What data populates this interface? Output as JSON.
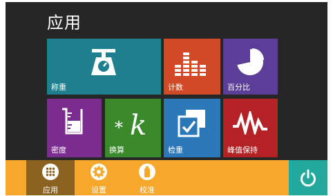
{
  "header": {
    "title": "应用"
  },
  "tiles": [
    {
      "label": "称重",
      "icon": "scale-icon",
      "color": "#1f7f8f"
    },
    {
      "label": "计数",
      "icon": "count-bars-icon",
      "color": "#d24a25"
    },
    {
      "label": "百分比",
      "icon": "pie-chart-icon",
      "color": "#5b3e98"
    },
    {
      "label": "密度",
      "icon": "beaker-icon",
      "color": "#7b2d8f"
    },
    {
      "label": "换算",
      "icon": "star-k-icon",
      "color": "#3a8a2c"
    },
    {
      "label": "检重",
      "icon": "check-weigh-icon",
      "color": "#2b78b8"
    },
    {
      "label": "峰值保持",
      "icon": "peak-wave-icon",
      "color": "#b52226"
    }
  ],
  "bottom_nav": {
    "items": [
      {
        "label": "应用",
        "icon": "grid-dots-icon",
        "active": true
      },
      {
        "label": "设置",
        "icon": "gear-icon",
        "active": false
      },
      {
        "label": "校准",
        "icon": "weight-icon",
        "active": false
      }
    ],
    "bar_color": "#f5a82c",
    "active_color": "#8a6321",
    "power_icon": "power-icon",
    "power_color": "#23a99c"
  }
}
